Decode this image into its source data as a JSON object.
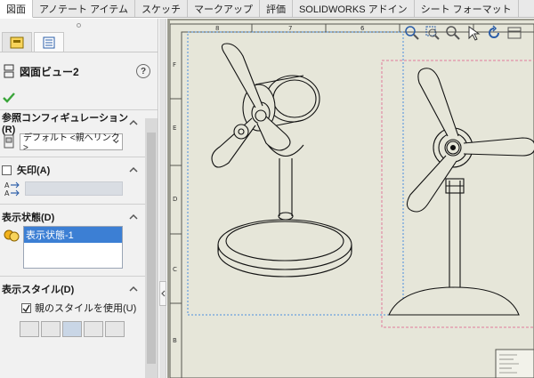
{
  "tabs": [
    {
      "label": "図面",
      "active": true
    },
    {
      "label": "アノテート アイテム"
    },
    {
      "label": "スケッチ"
    },
    {
      "label": "マークアップ"
    },
    {
      "label": "評価"
    },
    {
      "label": "SOLIDWORKS アドイン"
    },
    {
      "label": "シート フォーマット"
    }
  ],
  "property_manager": {
    "title": "図面ビュー2",
    "help_glyph": "?",
    "reference_config": {
      "header": "参照コンフィギュレーション(R)",
      "value": "デフォルト <親へリンク>"
    },
    "arrow": {
      "header": "矢印(A)",
      "checked": false
    },
    "display_state": {
      "header": "表示状態(D)",
      "selected": "表示状態-1"
    },
    "display_style": {
      "header": "表示スタイル(D)",
      "use_parent_label": "親のスタイルを使用(U)",
      "use_parent_checked": true
    }
  },
  "sheet": {
    "top_zone_labels": [
      "8",
      "7",
      "6"
    ],
    "side_zone_labels": [
      "F",
      "E",
      "D",
      "C",
      "B"
    ]
  },
  "colors": {
    "accent_selection": "#3c7fd4",
    "ok_check": "#3aa53a",
    "sheet_background": "#e6e6d9",
    "view_boundary_blue": "#4b8fe0",
    "view_boundary_pink": "#e07a9a"
  },
  "icons": {
    "heads_up": [
      "zoom-to-fit-icon",
      "zoom-to-area-icon",
      "zoom-in-out-icon",
      "select-icon",
      "rotate-icon",
      "pan-icon"
    ]
  }
}
